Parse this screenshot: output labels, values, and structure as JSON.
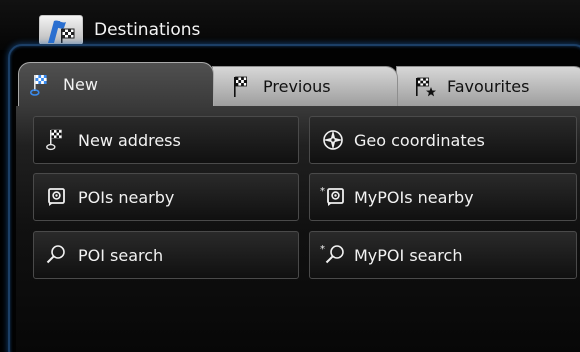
{
  "title": {
    "text": "Destinations",
    "icon": "destinations-flag-icon"
  },
  "tabs": [
    {
      "label": "New",
      "icon": "checkered-flag-icon",
      "active": true
    },
    {
      "label": "Previous",
      "icon": "checkered-flag-icon",
      "active": false
    },
    {
      "label": "Favourites",
      "icon": "checkered-flag-star-icon",
      "active": false
    }
  ],
  "buttons": [
    {
      "label": "New address",
      "icon": "checkered-flag-icon"
    },
    {
      "label": "Geo coordinates",
      "icon": "compass-icon"
    },
    {
      "label": "POIs nearby",
      "icon": "poi-icon"
    },
    {
      "label": "MyPOIs nearby",
      "icon": "my-poi-icon"
    },
    {
      "label": "POI search",
      "icon": "search-icon"
    },
    {
      "label": "MyPOI search",
      "icon": "my-search-icon"
    }
  ],
  "colors": {
    "accent_frame": "#1c3f66",
    "tab_active": "#444444",
    "tab_inactive": "#bdbdbd"
  }
}
